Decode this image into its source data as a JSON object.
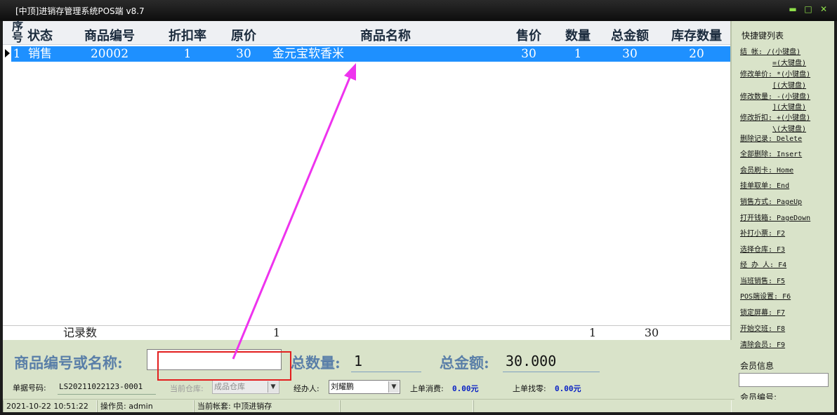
{
  "window": {
    "title": "[中顶]进销存管理系统POS端 v8.7",
    "buttons": {
      "minimize": "▬",
      "maximize": "□",
      "close": "✕"
    }
  },
  "grid": {
    "seq_header": "序号",
    "columns": [
      "状态",
      "商品编号",
      "折扣率",
      "原价",
      "商品名称",
      "售价",
      "数量",
      "总金额",
      "库存数量"
    ],
    "rows": [
      {
        "seq": "1",
        "status": "销售",
        "code": "20002",
        "discount": "1",
        "orig_price": "30",
        "name": "金元宝软香米",
        "price": "30",
        "qty": "1",
        "total": "30",
        "stock": "20"
      }
    ],
    "footer": {
      "label": "记录数",
      "count": "1",
      "qty": "1",
      "total": "30"
    }
  },
  "entry": {
    "code_label": "商品编号或名称:",
    "code_value": "",
    "total_qty_label": "总数量:",
    "total_qty": "1",
    "total_amount_label": "总金额:",
    "total_amount": "30.000"
  },
  "info": {
    "doc_no_label": "单据号码:",
    "doc_no": "LS20211022123-0001",
    "warehouse_label": "当前仓库:",
    "warehouse": "成品仓库",
    "handler_label": "经办人:",
    "handler": "刘耀鹏",
    "last_spend_label": "上单消费:",
    "last_spend": "0.00元",
    "last_change_label": "上单找零:",
    "last_change": "0.00元"
  },
  "status": {
    "datetime": "2021-10-22 10:51:22",
    "operator": "操作员: admin",
    "account": "当前帐套: 中顶进销存"
  },
  "sidebar": {
    "title": "快捷键列表",
    "hotkeys": [
      "结    帐: /(小键盘)",
      "=(大键盘)",
      "修改单价: *(小键盘)",
      "[(大键盘)",
      "修改数量: -(小键盘)",
      "](大键盘)",
      "修改折扣: +(小键盘)",
      "\\(大键盘)",
      "删除记录: Delete",
      "全部删除: Insert",
      "会员刷卡: Home",
      "挂单取单: End",
      "销售方式: PageUp",
      "打开钱箱: PageDown",
      "补打小票: F2",
      "选择仓库: F3",
      "经 办 人: F4",
      "当班销售: F5",
      "POS端设置: F6",
      "锁定屏幕: F7",
      "开始交班: F8",
      "清除会员: F9"
    ],
    "member_label": "会员信息",
    "member_no_label": "会员编号:"
  },
  "annotation_colors": {
    "arrow": "#ee33ee",
    "box": "#e31e1e"
  }
}
